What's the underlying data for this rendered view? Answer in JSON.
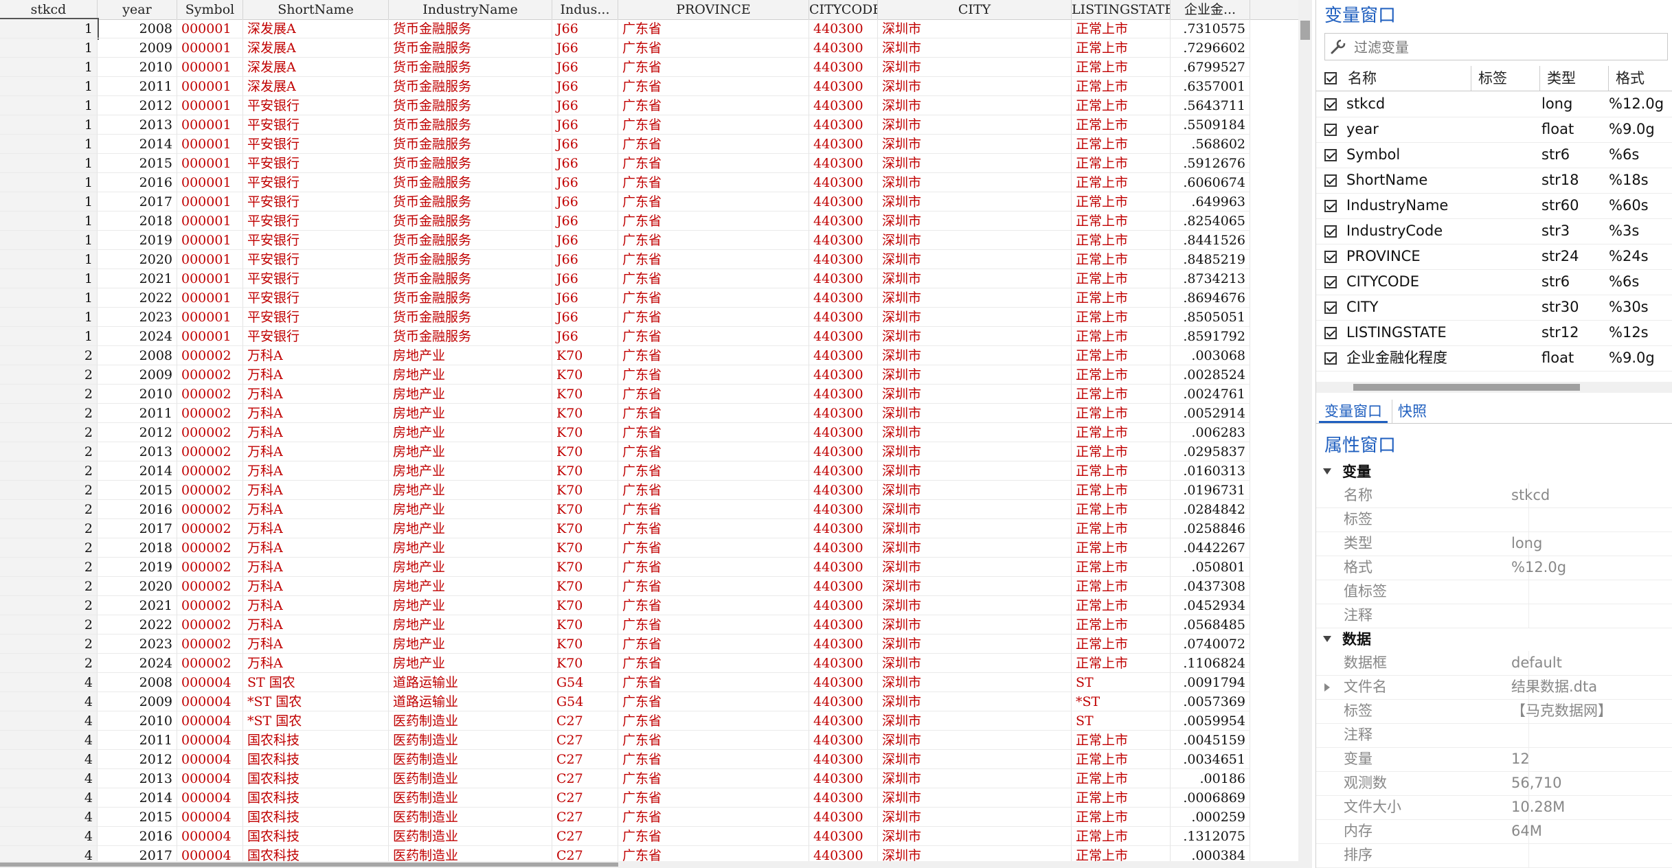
{
  "grid": {
    "columns": [
      "stkcd",
      "year",
      "Symbol",
      "ShortName",
      "IndustryName",
      "Indus...",
      "PROVINCE",
      "CITYCODE",
      "CITY",
      "LISTINGSTATE",
      "企业金..."
    ],
    "rows": [
      [
        "1",
        "2008",
        "000001",
        "深发展A",
        "货币金融服务",
        "J66",
        "广东省",
        "440300",
        "深圳市",
        "正常上市",
        ".7310575"
      ],
      [
        "1",
        "2009",
        "000001",
        "深发展A",
        "货币金融服务",
        "J66",
        "广东省",
        "440300",
        "深圳市",
        "正常上市",
        ".7296602"
      ],
      [
        "1",
        "2010",
        "000001",
        "深发展A",
        "货币金融服务",
        "J66",
        "广东省",
        "440300",
        "深圳市",
        "正常上市",
        ".6799527"
      ],
      [
        "1",
        "2011",
        "000001",
        "深发展A",
        "货币金融服务",
        "J66",
        "广东省",
        "440300",
        "深圳市",
        "正常上市",
        ".6357001"
      ],
      [
        "1",
        "2012",
        "000001",
        "平安银行",
        "货币金融服务",
        "J66",
        "广东省",
        "440300",
        "深圳市",
        "正常上市",
        ".5643711"
      ],
      [
        "1",
        "2013",
        "000001",
        "平安银行",
        "货币金融服务",
        "J66",
        "广东省",
        "440300",
        "深圳市",
        "正常上市",
        ".5509184"
      ],
      [
        "1",
        "2014",
        "000001",
        "平安银行",
        "货币金融服务",
        "J66",
        "广东省",
        "440300",
        "深圳市",
        "正常上市",
        ".568602"
      ],
      [
        "1",
        "2015",
        "000001",
        "平安银行",
        "货币金融服务",
        "J66",
        "广东省",
        "440300",
        "深圳市",
        "正常上市",
        ".5912676"
      ],
      [
        "1",
        "2016",
        "000001",
        "平安银行",
        "货币金融服务",
        "J66",
        "广东省",
        "440300",
        "深圳市",
        "正常上市",
        ".6060674"
      ],
      [
        "1",
        "2017",
        "000001",
        "平安银行",
        "货币金融服务",
        "J66",
        "广东省",
        "440300",
        "深圳市",
        "正常上市",
        ".649963"
      ],
      [
        "1",
        "2018",
        "000001",
        "平安银行",
        "货币金融服务",
        "J66",
        "广东省",
        "440300",
        "深圳市",
        "正常上市",
        ".8254065"
      ],
      [
        "1",
        "2019",
        "000001",
        "平安银行",
        "货币金融服务",
        "J66",
        "广东省",
        "440300",
        "深圳市",
        "正常上市",
        ".8441526"
      ],
      [
        "1",
        "2020",
        "000001",
        "平安银行",
        "货币金融服务",
        "J66",
        "广东省",
        "440300",
        "深圳市",
        "正常上市",
        ".8485219"
      ],
      [
        "1",
        "2021",
        "000001",
        "平安银行",
        "货币金融服务",
        "J66",
        "广东省",
        "440300",
        "深圳市",
        "正常上市",
        ".8734213"
      ],
      [
        "1",
        "2022",
        "000001",
        "平安银行",
        "货币金融服务",
        "J66",
        "广东省",
        "440300",
        "深圳市",
        "正常上市",
        ".8694676"
      ],
      [
        "1",
        "2023",
        "000001",
        "平安银行",
        "货币金融服务",
        "J66",
        "广东省",
        "440300",
        "深圳市",
        "正常上市",
        ".8505051"
      ],
      [
        "1",
        "2024",
        "000001",
        "平安银行",
        "货币金融服务",
        "J66",
        "广东省",
        "440300",
        "深圳市",
        "正常上市",
        ".8591792"
      ],
      [
        "2",
        "2008",
        "000002",
        "万科A",
        "房地产业",
        "K70",
        "广东省",
        "440300",
        "深圳市",
        "正常上市",
        ".003068"
      ],
      [
        "2",
        "2009",
        "000002",
        "万科A",
        "房地产业",
        "K70",
        "广东省",
        "440300",
        "深圳市",
        "正常上市",
        ".0028524"
      ],
      [
        "2",
        "2010",
        "000002",
        "万科A",
        "房地产业",
        "K70",
        "广东省",
        "440300",
        "深圳市",
        "正常上市",
        ".0024761"
      ],
      [
        "2",
        "2011",
        "000002",
        "万科A",
        "房地产业",
        "K70",
        "广东省",
        "440300",
        "深圳市",
        "正常上市",
        ".0052914"
      ],
      [
        "2",
        "2012",
        "000002",
        "万科A",
        "房地产业",
        "K70",
        "广东省",
        "440300",
        "深圳市",
        "正常上市",
        ".006283"
      ],
      [
        "2",
        "2013",
        "000002",
        "万科A",
        "房地产业",
        "K70",
        "广东省",
        "440300",
        "深圳市",
        "正常上市",
        ".0295837"
      ],
      [
        "2",
        "2014",
        "000002",
        "万科A",
        "房地产业",
        "K70",
        "广东省",
        "440300",
        "深圳市",
        "正常上市",
        ".0160313"
      ],
      [
        "2",
        "2015",
        "000002",
        "万科A",
        "房地产业",
        "K70",
        "广东省",
        "440300",
        "深圳市",
        "正常上市",
        ".0196731"
      ],
      [
        "2",
        "2016",
        "000002",
        "万科A",
        "房地产业",
        "K70",
        "广东省",
        "440300",
        "深圳市",
        "正常上市",
        ".0284842"
      ],
      [
        "2",
        "2017",
        "000002",
        "万科A",
        "房地产业",
        "K70",
        "广东省",
        "440300",
        "深圳市",
        "正常上市",
        ".0258846"
      ],
      [
        "2",
        "2018",
        "000002",
        "万科A",
        "房地产业",
        "K70",
        "广东省",
        "440300",
        "深圳市",
        "正常上市",
        ".0442267"
      ],
      [
        "2",
        "2019",
        "000002",
        "万科A",
        "房地产业",
        "K70",
        "广东省",
        "440300",
        "深圳市",
        "正常上市",
        ".050801"
      ],
      [
        "2",
        "2020",
        "000002",
        "万科A",
        "房地产业",
        "K70",
        "广东省",
        "440300",
        "深圳市",
        "正常上市",
        ".0437308"
      ],
      [
        "2",
        "2021",
        "000002",
        "万科A",
        "房地产业",
        "K70",
        "广东省",
        "440300",
        "深圳市",
        "正常上市",
        ".0452934"
      ],
      [
        "2",
        "2022",
        "000002",
        "万科A",
        "房地产业",
        "K70",
        "广东省",
        "440300",
        "深圳市",
        "正常上市",
        ".0568485"
      ],
      [
        "2",
        "2023",
        "000002",
        "万科A",
        "房地产业",
        "K70",
        "广东省",
        "440300",
        "深圳市",
        "正常上市",
        ".0740072"
      ],
      [
        "2",
        "2024",
        "000002",
        "万科A",
        "房地产业",
        "K70",
        "广东省",
        "440300",
        "深圳市",
        "正常上市",
        ".1106824"
      ],
      [
        "4",
        "2008",
        "000004",
        "ST 国农",
        "道路运输业",
        "G54",
        "广东省",
        "440300",
        "深圳市",
        "ST",
        ".0091794"
      ],
      [
        "4",
        "2009",
        "000004",
        "*ST 国农",
        "道路运输业",
        "G54",
        "广东省",
        "440300",
        "深圳市",
        "*ST",
        ".0057369"
      ],
      [
        "4",
        "2010",
        "000004",
        "*ST 国农",
        "医药制造业",
        "C27",
        "广东省",
        "440300",
        "深圳市",
        "ST",
        ".0059954"
      ],
      [
        "4",
        "2011",
        "000004",
        "国农科技",
        "医药制造业",
        "C27",
        "广东省",
        "440300",
        "深圳市",
        "正常上市",
        ".0045159"
      ],
      [
        "4",
        "2012",
        "000004",
        "国农科技",
        "医药制造业",
        "C27",
        "广东省",
        "440300",
        "深圳市",
        "正常上市",
        ".0034651"
      ],
      [
        "4",
        "2013",
        "000004",
        "国农科技",
        "医药制造业",
        "C27",
        "广东省",
        "440300",
        "深圳市",
        "正常上市",
        ".00186"
      ],
      [
        "4",
        "2014",
        "000004",
        "国农科技",
        "医药制造业",
        "C27",
        "广东省",
        "440300",
        "深圳市",
        "正常上市",
        ".0006869"
      ],
      [
        "4",
        "2015",
        "000004",
        "国农科技",
        "医药制造业",
        "C27",
        "广东省",
        "440300",
        "深圳市",
        "正常上市",
        ".000259"
      ],
      [
        "4",
        "2016",
        "000004",
        "国农科技",
        "医药制造业",
        "C27",
        "广东省",
        "440300",
        "深圳市",
        "正常上市",
        ".1312075"
      ],
      [
        "4",
        "2017",
        "000004",
        "国农科技",
        "医药制造业",
        "C27",
        "广东省",
        "440300",
        "深圳市",
        "正常上市",
        ".000384"
      ]
    ]
  },
  "variables_window": {
    "title": "变量窗口",
    "filter_placeholder": "过滤变量",
    "headers": {
      "name": "名称",
      "label": "标签",
      "type": "类型",
      "format": "格式"
    },
    "items": [
      {
        "name": "stkcd",
        "type": "long",
        "format": "%12.0g"
      },
      {
        "name": "year",
        "type": "float",
        "format": "%9.0g"
      },
      {
        "name": "Symbol",
        "type": "str6",
        "format": "%6s"
      },
      {
        "name": "ShortName",
        "type": "str18",
        "format": "%18s"
      },
      {
        "name": "IndustryName",
        "type": "str60",
        "format": "%60s"
      },
      {
        "name": "IndustryCode",
        "type": "str3",
        "format": "%3s"
      },
      {
        "name": "PROVINCE",
        "type": "str24",
        "format": "%24s"
      },
      {
        "name": "CITYCODE",
        "type": "str6",
        "format": "%6s"
      },
      {
        "name": "CITY",
        "type": "str30",
        "format": "%30s"
      },
      {
        "name": "LISTINGSTATE",
        "type": "str12",
        "format": "%12s"
      },
      {
        "name": "企业金融化程度",
        "type": "float",
        "format": "%9.0g"
      }
    ]
  },
  "tabs": {
    "variables": "变量窗口",
    "snapshots": "快照"
  },
  "properties_window": {
    "title": "属性窗口",
    "variable_section": "变量",
    "variable_rows": [
      {
        "key": "名称",
        "value": "stkcd"
      },
      {
        "key": "标签",
        "value": ""
      },
      {
        "key": "类型",
        "value": "long"
      },
      {
        "key": "格式",
        "value": "%12.0g"
      },
      {
        "key": "值标签",
        "value": ""
      },
      {
        "key": "注释",
        "value": ""
      }
    ],
    "data_section": "数据",
    "data_rows": [
      {
        "key": "数据框",
        "value": "default"
      },
      {
        "key": "文件名",
        "value": "结果数据.dta"
      },
      {
        "key": "标签",
        "value": "【马克数据网】"
      },
      {
        "key": "注释",
        "value": ""
      },
      {
        "key": "变量",
        "value": "12"
      },
      {
        "key": "观测数",
        "value": "56,710"
      },
      {
        "key": "文件大小",
        "value": "10.28M"
      },
      {
        "key": "内存",
        "value": "64M"
      },
      {
        "key": "排序",
        "value": ""
      }
    ]
  },
  "colors": {
    "string_text": "#c00000",
    "accent": "#1f5fbf"
  }
}
